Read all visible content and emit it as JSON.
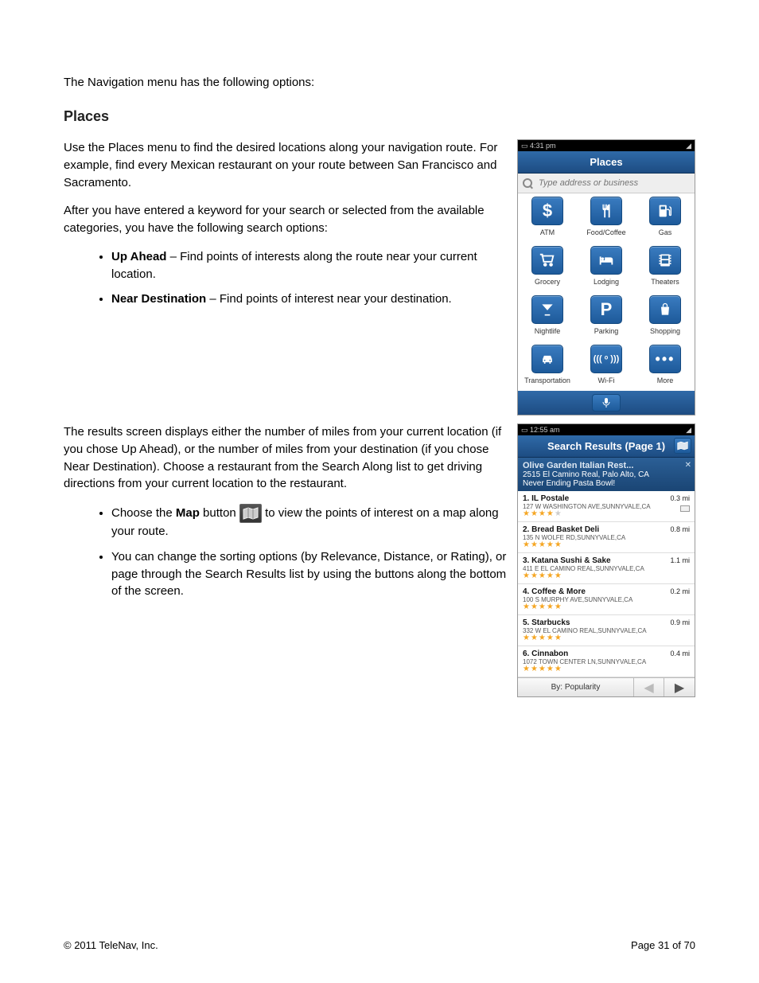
{
  "intro_line": "The Navigation menu has the following options:",
  "section_heading": "Places",
  "paras": {
    "p1": "Use the Places menu to find the desired locations along your navigation route. For example, find every Mexican restaurant on your route between San Francisco and Sacramento.",
    "p2": "After you have entered a keyword for your search or selected from the available categories, you have the following search options:",
    "b1_label": "Up Ahead",
    "b1_rest": " – Find points of interests along the route near your current location.",
    "b2_label": "Near Destination",
    "b2_rest": " – Find points of interest near your destination.",
    "p3": "The results screen displays either the number of miles from your current location (if you chose Up Ahead), or the number of miles from your destination (if you chose Near Destination). Choose a restaurant from the Search Along list to get driving directions from your current location to the restaurant.",
    "b3_pre": "Choose the ",
    "b3_bold": "Map",
    "b3_mid": " button ",
    "b3_post": " to view the points of interest on a map along your route.",
    "b4": "You can change the sorting options (by Relevance, Distance, or Rating), or page through the Search Results list by using the buttons along the bottom of the screen."
  },
  "places_mock": {
    "status_time": "4:31 pm",
    "title": "Places",
    "search_placeholder": "Type address or business",
    "cats": [
      {
        "label": "ATM",
        "glyph": "$"
      },
      {
        "label": "Food/Coffee",
        "glyph": "fork"
      },
      {
        "label": "Gas",
        "glyph": "pump"
      },
      {
        "label": "Grocery",
        "glyph": "cart"
      },
      {
        "label": "Lodging",
        "glyph": "bed"
      },
      {
        "label": "Theaters",
        "glyph": "film"
      },
      {
        "label": "Nightlife",
        "glyph": "martini"
      },
      {
        "label": "Parking",
        "glyph": "P"
      },
      {
        "label": "Shopping",
        "glyph": "bag"
      },
      {
        "label": "Transportation",
        "glyph": "car"
      },
      {
        "label": "Wi-Fi",
        "glyph": "wifi"
      },
      {
        "label": "More",
        "glyph": "dots"
      }
    ]
  },
  "results_mock": {
    "status_time": "12:55 am",
    "title": "Search Results (Page 1)",
    "featured": {
      "name": "Olive Garden Italian Rest...",
      "addr": "2515 El Camino Real, Palo Alto, CA",
      "tag": "Never Ending Pasta Bowl!"
    },
    "items": [
      {
        "n": "1.",
        "name": "IL Postale",
        "addr": "127 W WASHINGTON AVE,SUNNYVALE,CA",
        "stars": 4,
        "dist": "0.3 mi",
        "sponsor": true
      },
      {
        "n": "2.",
        "name": "Bread Basket Deli",
        "addr": "135 N WOLFE RD,SUNNYVALE,CA",
        "stars": 5,
        "dist": "0.8 mi"
      },
      {
        "n": "3.",
        "name": "Katana Sushi & Sake",
        "addr": "411 E EL CAMINO REAL,SUNNYVALE,CA",
        "stars": 5,
        "dist": "1.1 mi"
      },
      {
        "n": "4.",
        "name": "Coffee & More",
        "addr": "100 S MURPHY AVE,SUNNYVALE,CA",
        "stars": 5,
        "dist": "0.2 mi"
      },
      {
        "n": "5.",
        "name": "Starbucks",
        "addr": "332 W EL CAMINO REAL,SUNNYVALE,CA",
        "stars": 5,
        "dist": "0.9 mi"
      },
      {
        "n": "6.",
        "name": "Cinnabon",
        "addr": "1072 TOWN CENTER LN,SUNNYVALE,CA",
        "stars": 5,
        "dist": "0.4 mi"
      }
    ],
    "sort_label": "By: Popularity"
  },
  "footer": {
    "copyright": "© 2011 TeleNav, Inc.",
    "page": "Page 31 of 70"
  }
}
